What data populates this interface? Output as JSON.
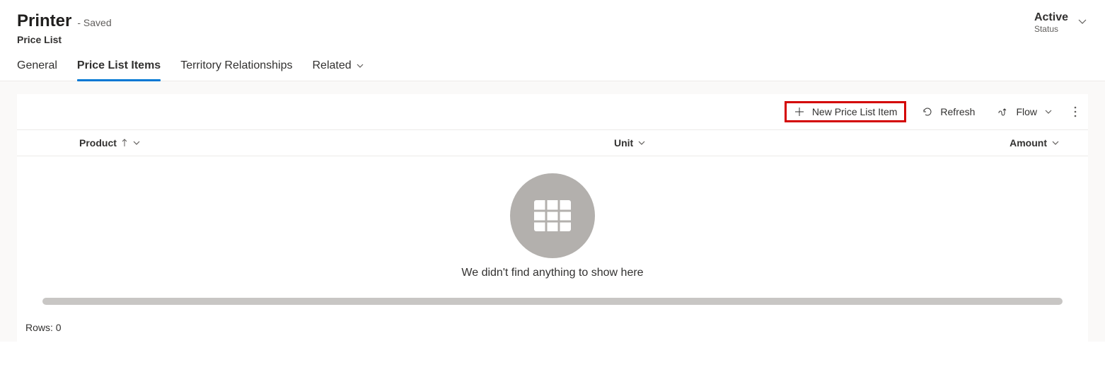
{
  "header": {
    "title": "Printer",
    "save_state": "- Saved",
    "entity_type": "Price List",
    "status_value": "Active",
    "status_label": "Status"
  },
  "tabs": {
    "general": "General",
    "price_list_items": "Price List Items",
    "territory": "Territory Relationships",
    "related": "Related"
  },
  "toolbar": {
    "new_item": "New Price List Item",
    "refresh": "Refresh",
    "flow": "Flow"
  },
  "columns": {
    "product": "Product",
    "unit": "Unit",
    "amount": "Amount"
  },
  "empty_state": {
    "message": "We didn't find anything to show here"
  },
  "footer": {
    "rows_label": "Rows: 0"
  }
}
